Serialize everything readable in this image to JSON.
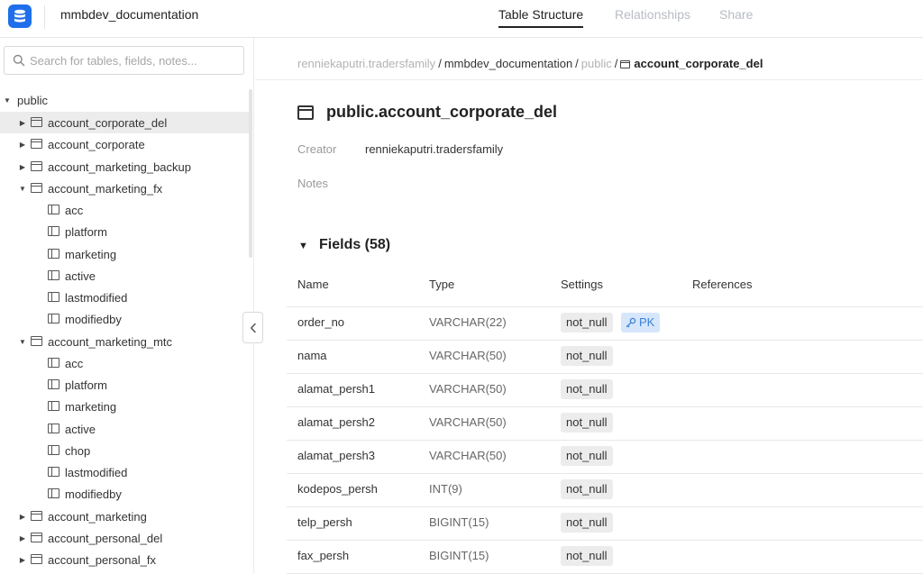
{
  "header": {
    "project_title": "mmbdev_documentation",
    "tabs": [
      {
        "label": "Table Structure",
        "active": true
      },
      {
        "label": "Relationships",
        "active": false
      },
      {
        "label": "Share",
        "active": false
      }
    ]
  },
  "sidebar": {
    "search_placeholder": "Search for tables, fields, notes...",
    "schema": "public",
    "rows": [
      {
        "label": "account_corporate_del",
        "kind": "table",
        "expanded": false,
        "selected": true
      },
      {
        "label": "account_corporate",
        "kind": "table",
        "expanded": false
      },
      {
        "label": "account_marketing_backup",
        "kind": "table",
        "expanded": false
      },
      {
        "label": "account_marketing_fx",
        "kind": "table",
        "expanded": true
      },
      {
        "label": "acc",
        "kind": "field"
      },
      {
        "label": "platform",
        "kind": "field"
      },
      {
        "label": "marketing",
        "kind": "field"
      },
      {
        "label": "active",
        "kind": "field"
      },
      {
        "label": "lastmodified",
        "kind": "field"
      },
      {
        "label": "modifiedby",
        "kind": "field"
      },
      {
        "label": "account_marketing_mtc",
        "kind": "table",
        "expanded": true
      },
      {
        "label": "acc",
        "kind": "field"
      },
      {
        "label": "platform",
        "kind": "field"
      },
      {
        "label": "marketing",
        "kind": "field"
      },
      {
        "label": "active",
        "kind": "field"
      },
      {
        "label": "chop",
        "kind": "field"
      },
      {
        "label": "lastmodified",
        "kind": "field"
      },
      {
        "label": "modifiedby",
        "kind": "field"
      },
      {
        "label": "account_marketing",
        "kind": "table",
        "expanded": false
      },
      {
        "label": "account_personal_del",
        "kind": "table",
        "expanded": false
      },
      {
        "label": "account_personal_fx",
        "kind": "table",
        "expanded": false
      }
    ]
  },
  "breadcrumb": {
    "owner": "renniekaputri.tradersfamily",
    "project": "mmbdev_documentation",
    "schema": "public",
    "table": "account_corporate_del",
    "separator": "/"
  },
  "table": {
    "title": "public.account_corporate_del",
    "creator_label": "Creator",
    "creator_value": "renniekaputri.tradersfamily",
    "notes_label": "Notes",
    "fields_title": "Fields (58)",
    "columns": {
      "name": "Name",
      "type": "Type",
      "settings": "Settings",
      "references": "References"
    },
    "fields": [
      {
        "name": "order_no",
        "type": "VARCHAR(22)",
        "setting": "not_null",
        "pk": "PK"
      },
      {
        "name": "nama",
        "type": "VARCHAR(50)",
        "setting": "not_null"
      },
      {
        "name": "alamat_persh1",
        "type": "VARCHAR(50)",
        "setting": "not_null"
      },
      {
        "name": "alamat_persh2",
        "type": "VARCHAR(50)",
        "setting": "not_null"
      },
      {
        "name": "alamat_persh3",
        "type": "VARCHAR(50)",
        "setting": "not_null"
      },
      {
        "name": "kodepos_persh",
        "type": "INT(9)",
        "setting": "not_null"
      },
      {
        "name": "telp_persh",
        "type": "BIGINT(15)",
        "setting": "not_null"
      },
      {
        "name": "fax_persh",
        "type": "BIGINT(15)",
        "setting": "not_null"
      }
    ]
  },
  "colors": {
    "accent": "#1f6feb",
    "pk_bg": "#d6e6fb",
    "pk_text": "#3b82d6",
    "badge_bg": "#ececec"
  }
}
